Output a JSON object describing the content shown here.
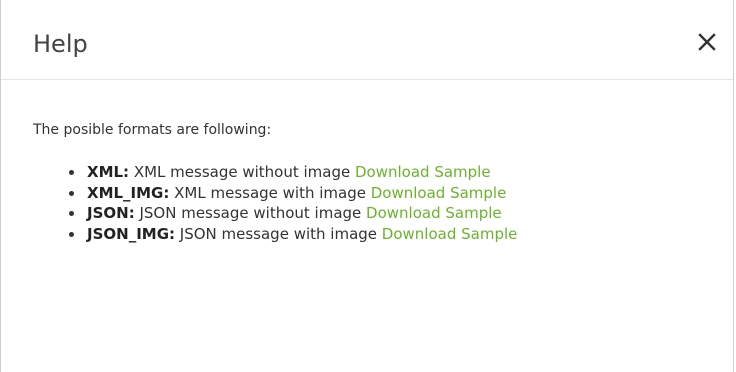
{
  "dialog": {
    "title": "Help",
    "close_label": "×"
  },
  "body": {
    "intro": "The posible formats are following:",
    "formats": [
      {
        "name": "XML:",
        "description": " XML message without image ",
        "link": "Download Sample"
      },
      {
        "name": "XML_IMG:",
        "description": " XML message with image ",
        "link": "Download Sample"
      },
      {
        "name": "JSON:",
        "description": " JSON message without image ",
        "link": "Download Sample"
      },
      {
        "name": "JSON_IMG:",
        "description": " JSON message with image ",
        "link": "Download Sample"
      }
    ]
  },
  "colors": {
    "link": "#6ab42d",
    "title": "#444444",
    "text": "#333333",
    "divider": "#e6e6e6"
  },
  "icons": {
    "close": "close-icon"
  }
}
